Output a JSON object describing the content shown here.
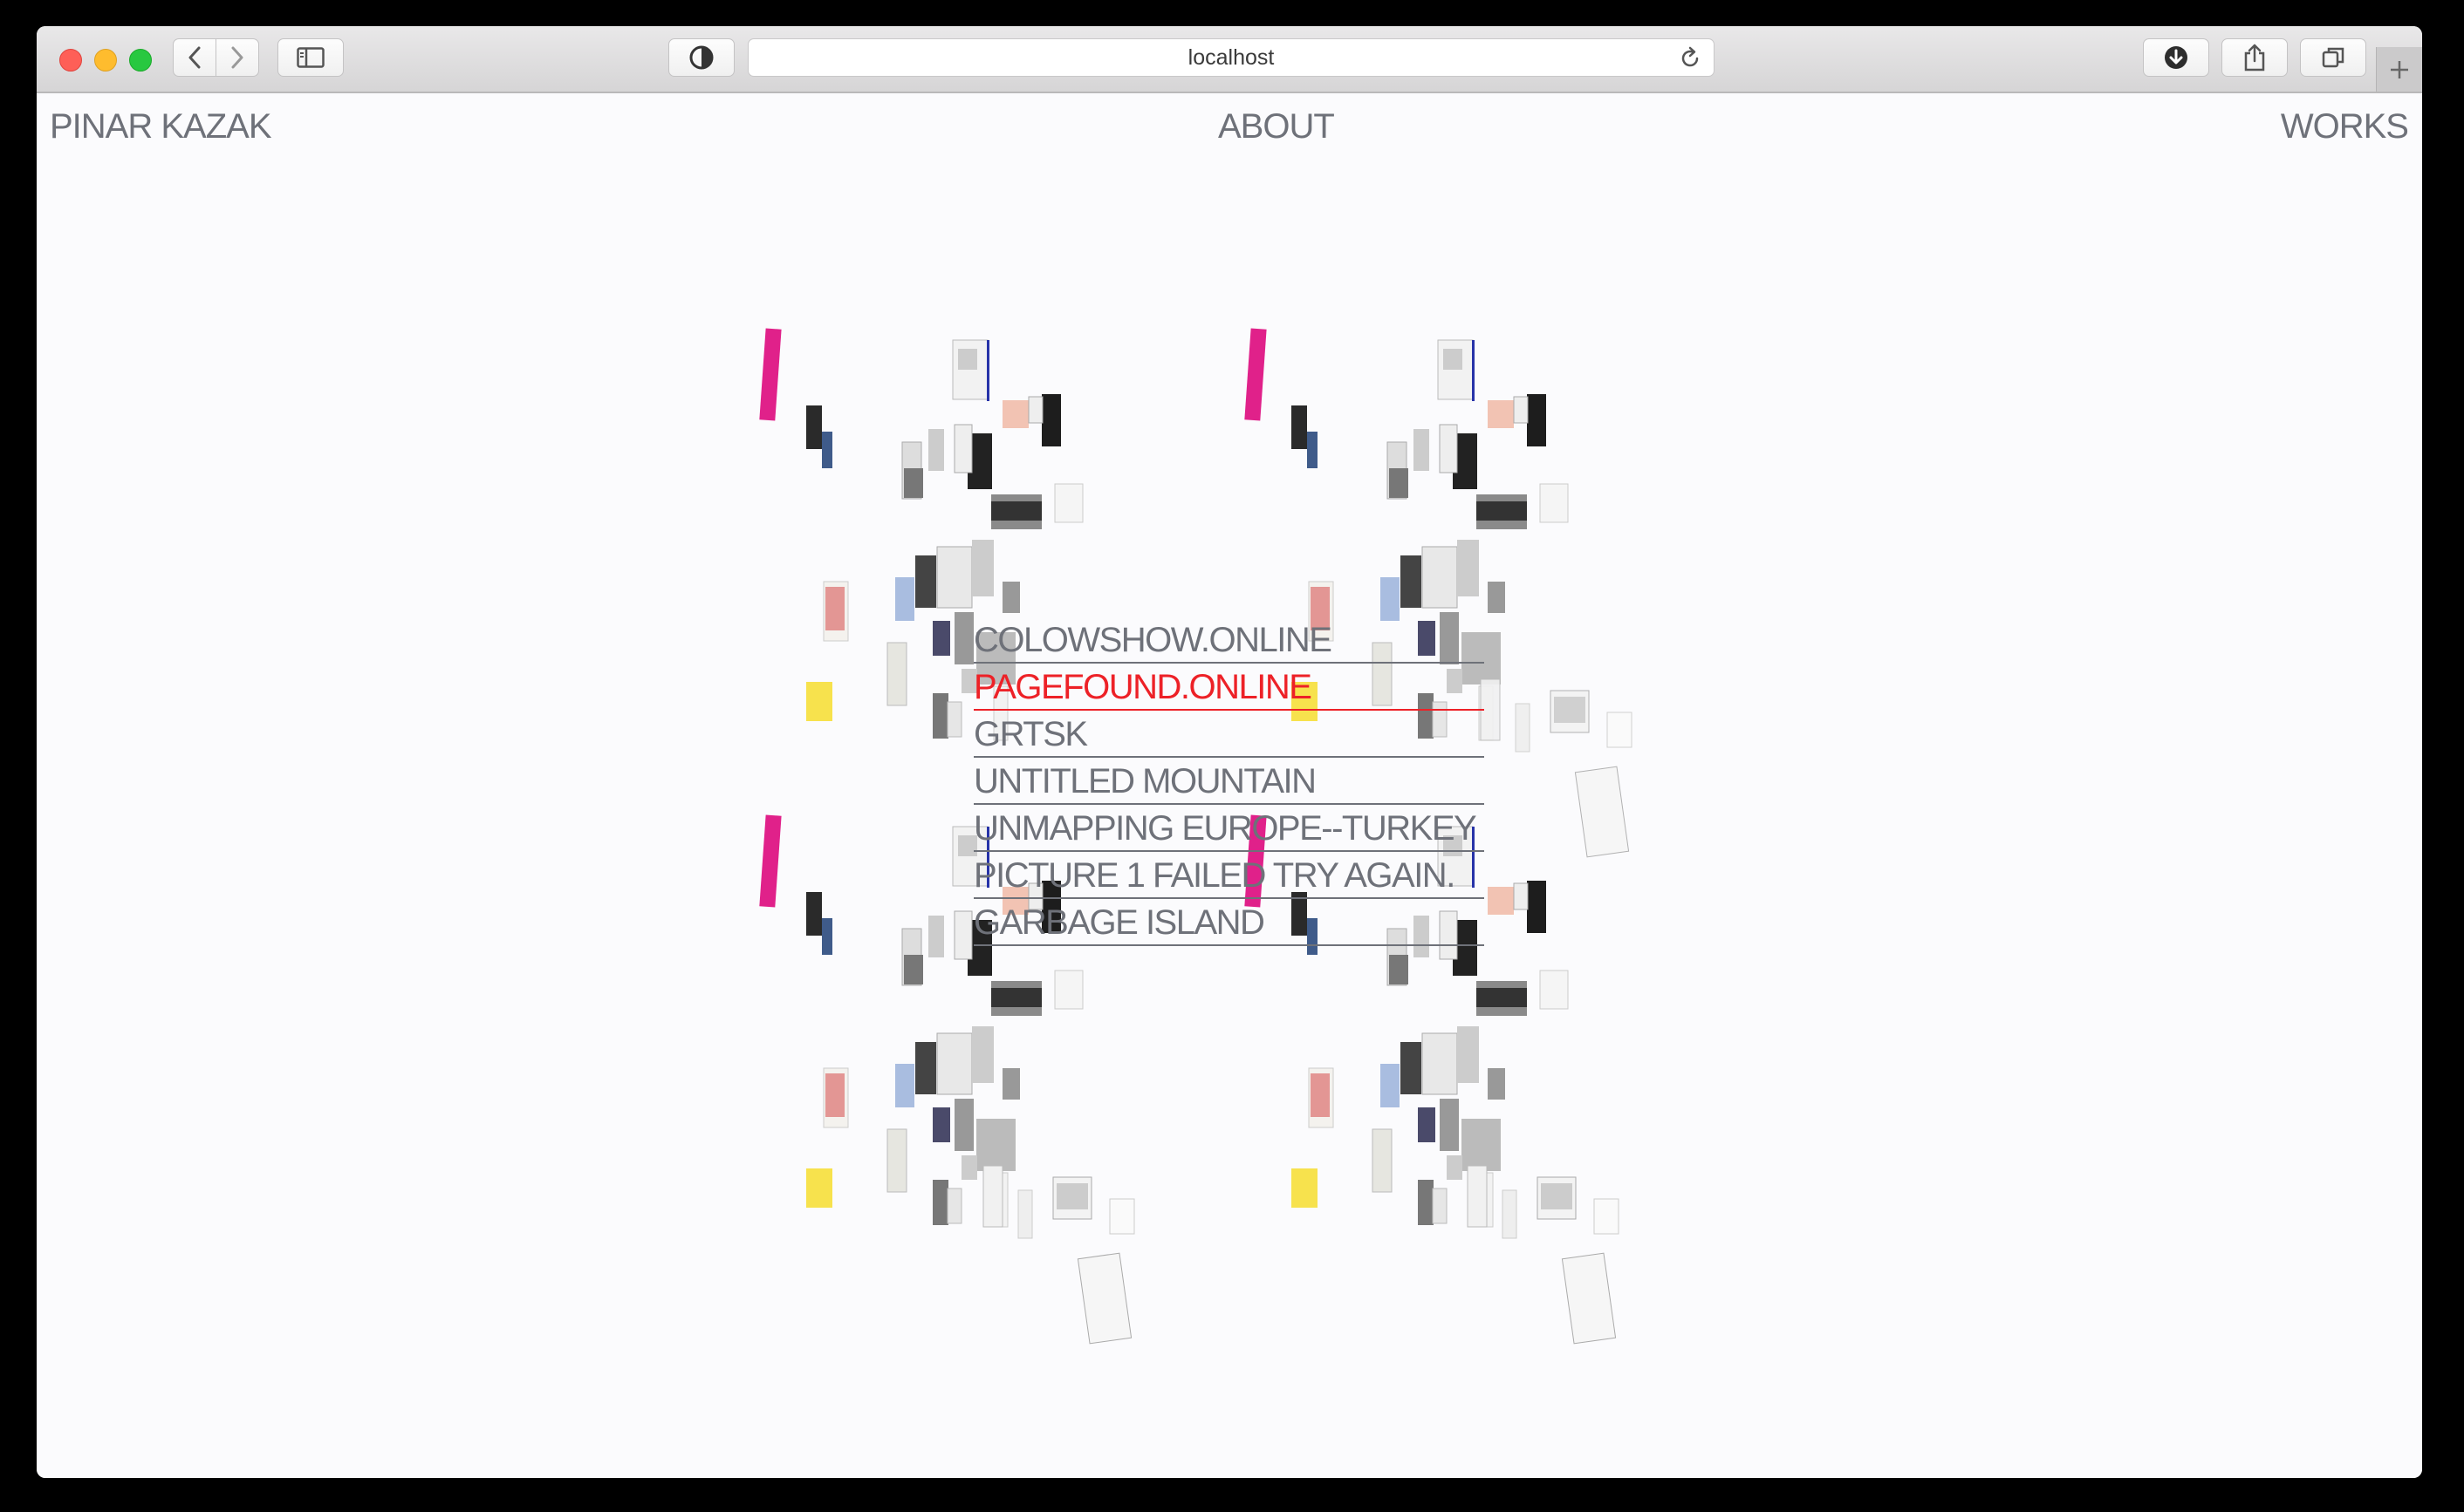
{
  "browser": {
    "address": "localhost"
  },
  "site": {
    "brand": "PINAR KAZAK",
    "nav": {
      "about": "ABOUT",
      "works": "WORKS"
    }
  },
  "works": [
    {
      "label": "COLOWSHOW.ONLINE"
    },
    {
      "label": "PAGEFOUND.ONLINE"
    },
    {
      "label": "GRTSK"
    },
    {
      "label": "UNTITLED MOUNTAIN"
    },
    {
      "label": "UNMAPPING EUROPE--TURKEY"
    },
    {
      "label": "PICTURE 1 FAILED TRY AGAIN."
    },
    {
      "label": "GARBAGE ISLAND"
    }
  ],
  "active_work": "PAGEFOUND.ONLINE",
  "colors": {
    "text": "#6e7179",
    "active": "#ed2127",
    "background": "#fbfbfd"
  }
}
